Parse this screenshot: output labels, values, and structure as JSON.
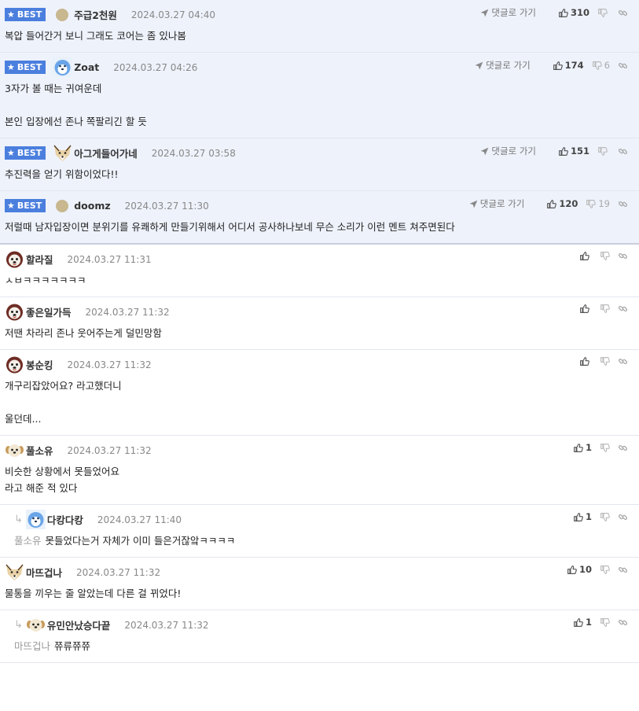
{
  "ui": {
    "best_label": "BEST",
    "goto_label": "댓글로 가기"
  },
  "best_comments": [
    {
      "nick": "주급2천원",
      "date": "2024.03.27 04:40",
      "avatar": "dot-avatar",
      "likes": "310",
      "dislikes": "",
      "lines": [
        "복압 들어간거 보니 그래도 코어는 좀 있나봄"
      ]
    },
    {
      "nick": "Zoat",
      "date": "2024.03.27 04:26",
      "avatar": "blue-bear-avatar",
      "likes": "174",
      "dislikes": "6",
      "lines": [
        "3자가 볼 때는 귀여운데",
        "",
        "본인 입장에선 존나 쪽팔리긴 할 듯"
      ]
    },
    {
      "nick": "아그게들어가네",
      "date": "2024.03.27 03:58",
      "avatar": "fox-avatar",
      "likes": "151",
      "dislikes": "",
      "lines": [
        "추진력을 얻기 위함이었다!!"
      ]
    },
    {
      "nick": "doomz",
      "date": "2024.03.27 11:30",
      "avatar": "dot-avatar",
      "likes": "120",
      "dislikes": "19",
      "lines": [
        "저럴때 남자입장이면 분위기를 유쾌하게 만들기위해서 어디서 공사하나보네 무슨 소리가 이런 멘트 쳐주면된다"
      ]
    }
  ],
  "comments": [
    {
      "nick": "할라질",
      "date": "2024.03.27 11:31",
      "avatar": "dog-avatar",
      "likes": "",
      "lines": [
        "ㅅㅂㅋㅋㅋㅋㅋㅋㅋ"
      ]
    },
    {
      "nick": "좋은일가득",
      "date": "2024.03.27 11:32",
      "avatar": "dog-avatar",
      "likes": "",
      "lines": [
        "저땐 차라리 존나 웃어주는게 덜민망함"
      ]
    },
    {
      "nick": "봉순킹",
      "date": "2024.03.27 11:32",
      "avatar": "dog-avatar",
      "likes": "",
      "lines": [
        "개구리잡았어요? 라고했더니",
        "",
        "울던데..."
      ]
    },
    {
      "nick": "풀소유",
      "date": "2024.03.27 11:32",
      "avatar": "puppy-avatar",
      "likes": "1",
      "lines": [
        "비슷한 상황에서 못들었어요",
        "라고 해준 적 있다"
      ]
    },
    {
      "nick": "다캉다캉",
      "date": "2024.03.27 11:40",
      "avatar": "blue-bear-avatar",
      "likes": "1",
      "reply": true,
      "mention": "풀소유",
      "lines": [
        "못들었다는거 자체가 이미 들은거잖앜ㅋㅋㅋㅋ"
      ]
    },
    {
      "nick": "마뜨겁나",
      "date": "2024.03.27 11:32",
      "avatar": "fox-avatar",
      "likes": "10",
      "lines": [
        "물통을 끼우는 줄 알았는데 다른 걸 뀌었다!"
      ]
    },
    {
      "nick": "유민안났승다끝",
      "date": "2024.03.27 11:32",
      "avatar": "puppy-avatar",
      "likes": "1",
      "reply": true,
      "mention": "마뜨겁나",
      "lines": [
        "쮸류쮸쮸"
      ]
    }
  ]
}
